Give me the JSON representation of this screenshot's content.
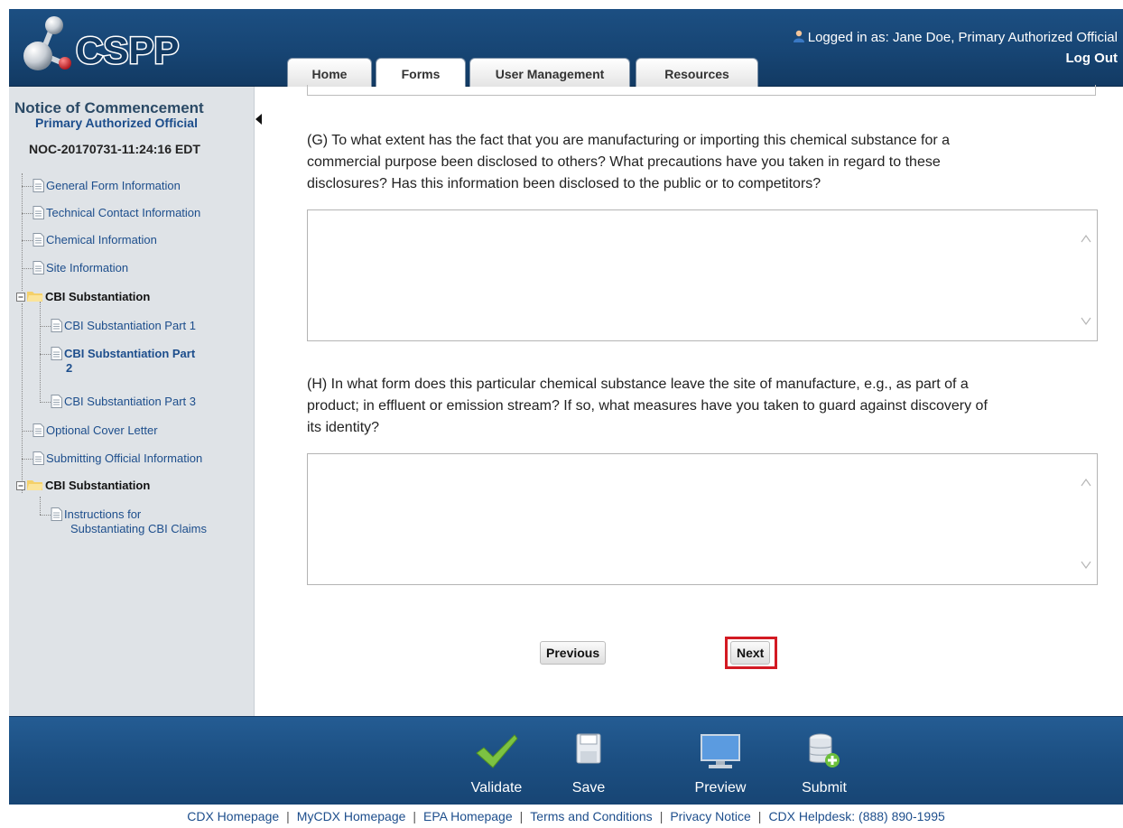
{
  "header": {
    "logo_text": "CSPP",
    "logged_in_label": "Logged in as:",
    "logged_in_user": "Jane Doe, Primary Authorized Official",
    "logout": "Log Out"
  },
  "tabs": [
    {
      "label": "Home"
    },
    {
      "label": "Forms",
      "active": true
    },
    {
      "label": "User Management"
    },
    {
      "label": "Resources"
    }
  ],
  "sidebar": {
    "title": "Notice of Commencement",
    "role": "Primary Authorized Official",
    "submission_id": "NOC-20170731-11:24:16 EDT",
    "items": [
      {
        "label": "General Form Information"
      },
      {
        "label": "Technical Contact Information"
      },
      {
        "label": "Chemical Information"
      },
      {
        "label": "Site Information"
      },
      {
        "label": "CBI Substantiation"
      },
      {
        "label": "CBI Substantiation Part 1"
      },
      {
        "label": "CBI Substantiation Part"
      },
      {
        "label": "2"
      },
      {
        "label": "CBI Substantiation Part 3"
      },
      {
        "label": "Optional Cover Letter"
      },
      {
        "label": "Submitting Official Information"
      },
      {
        "label": "CBI Substantiation"
      },
      {
        "label": "Instructions for"
      },
      {
        "label": "Substantiating CBI Claims"
      }
    ]
  },
  "main": {
    "question_g": [
      "(G) To what extent has the fact that you are manufacturing or importing this chemical substance for a",
      "commercial purpose been disclosed to others? What precautions have you taken in regard to these",
      "disclosures? Has this information been disclosed to the public or to competitors?"
    ],
    "question_h": [
      "(H) In what form does this particular chemical substance leave the site of manufacture, e.g., as part of a",
      "product; in effluent or emission stream? If so, what measures have you taken to guard against discovery of",
      "its identity?"
    ],
    "answer_g": "",
    "answer_h": "",
    "previous_label": "Previous",
    "next_label": "Next"
  },
  "actions": [
    {
      "label": "Validate",
      "icon": "checkmark-icon"
    },
    {
      "label": "Save",
      "icon": "floppy-disk-icon"
    },
    {
      "label": "Preview",
      "icon": "monitor-icon"
    },
    {
      "label": "Submit",
      "icon": "database-add-icon"
    }
  ],
  "footer": [
    "CDX Homepage",
    "MyCDX Homepage",
    "EPA Homepage",
    "Terms and Conditions",
    "Privacy Notice",
    "CDX Helpdesk: (888) 890-1995"
  ],
  "colors": {
    "header_blue": "#1c4f82",
    "link_blue": "#1d4e8c",
    "sidebar_bg": "#dfe3e7",
    "highlight_red": "#d31a23"
  }
}
